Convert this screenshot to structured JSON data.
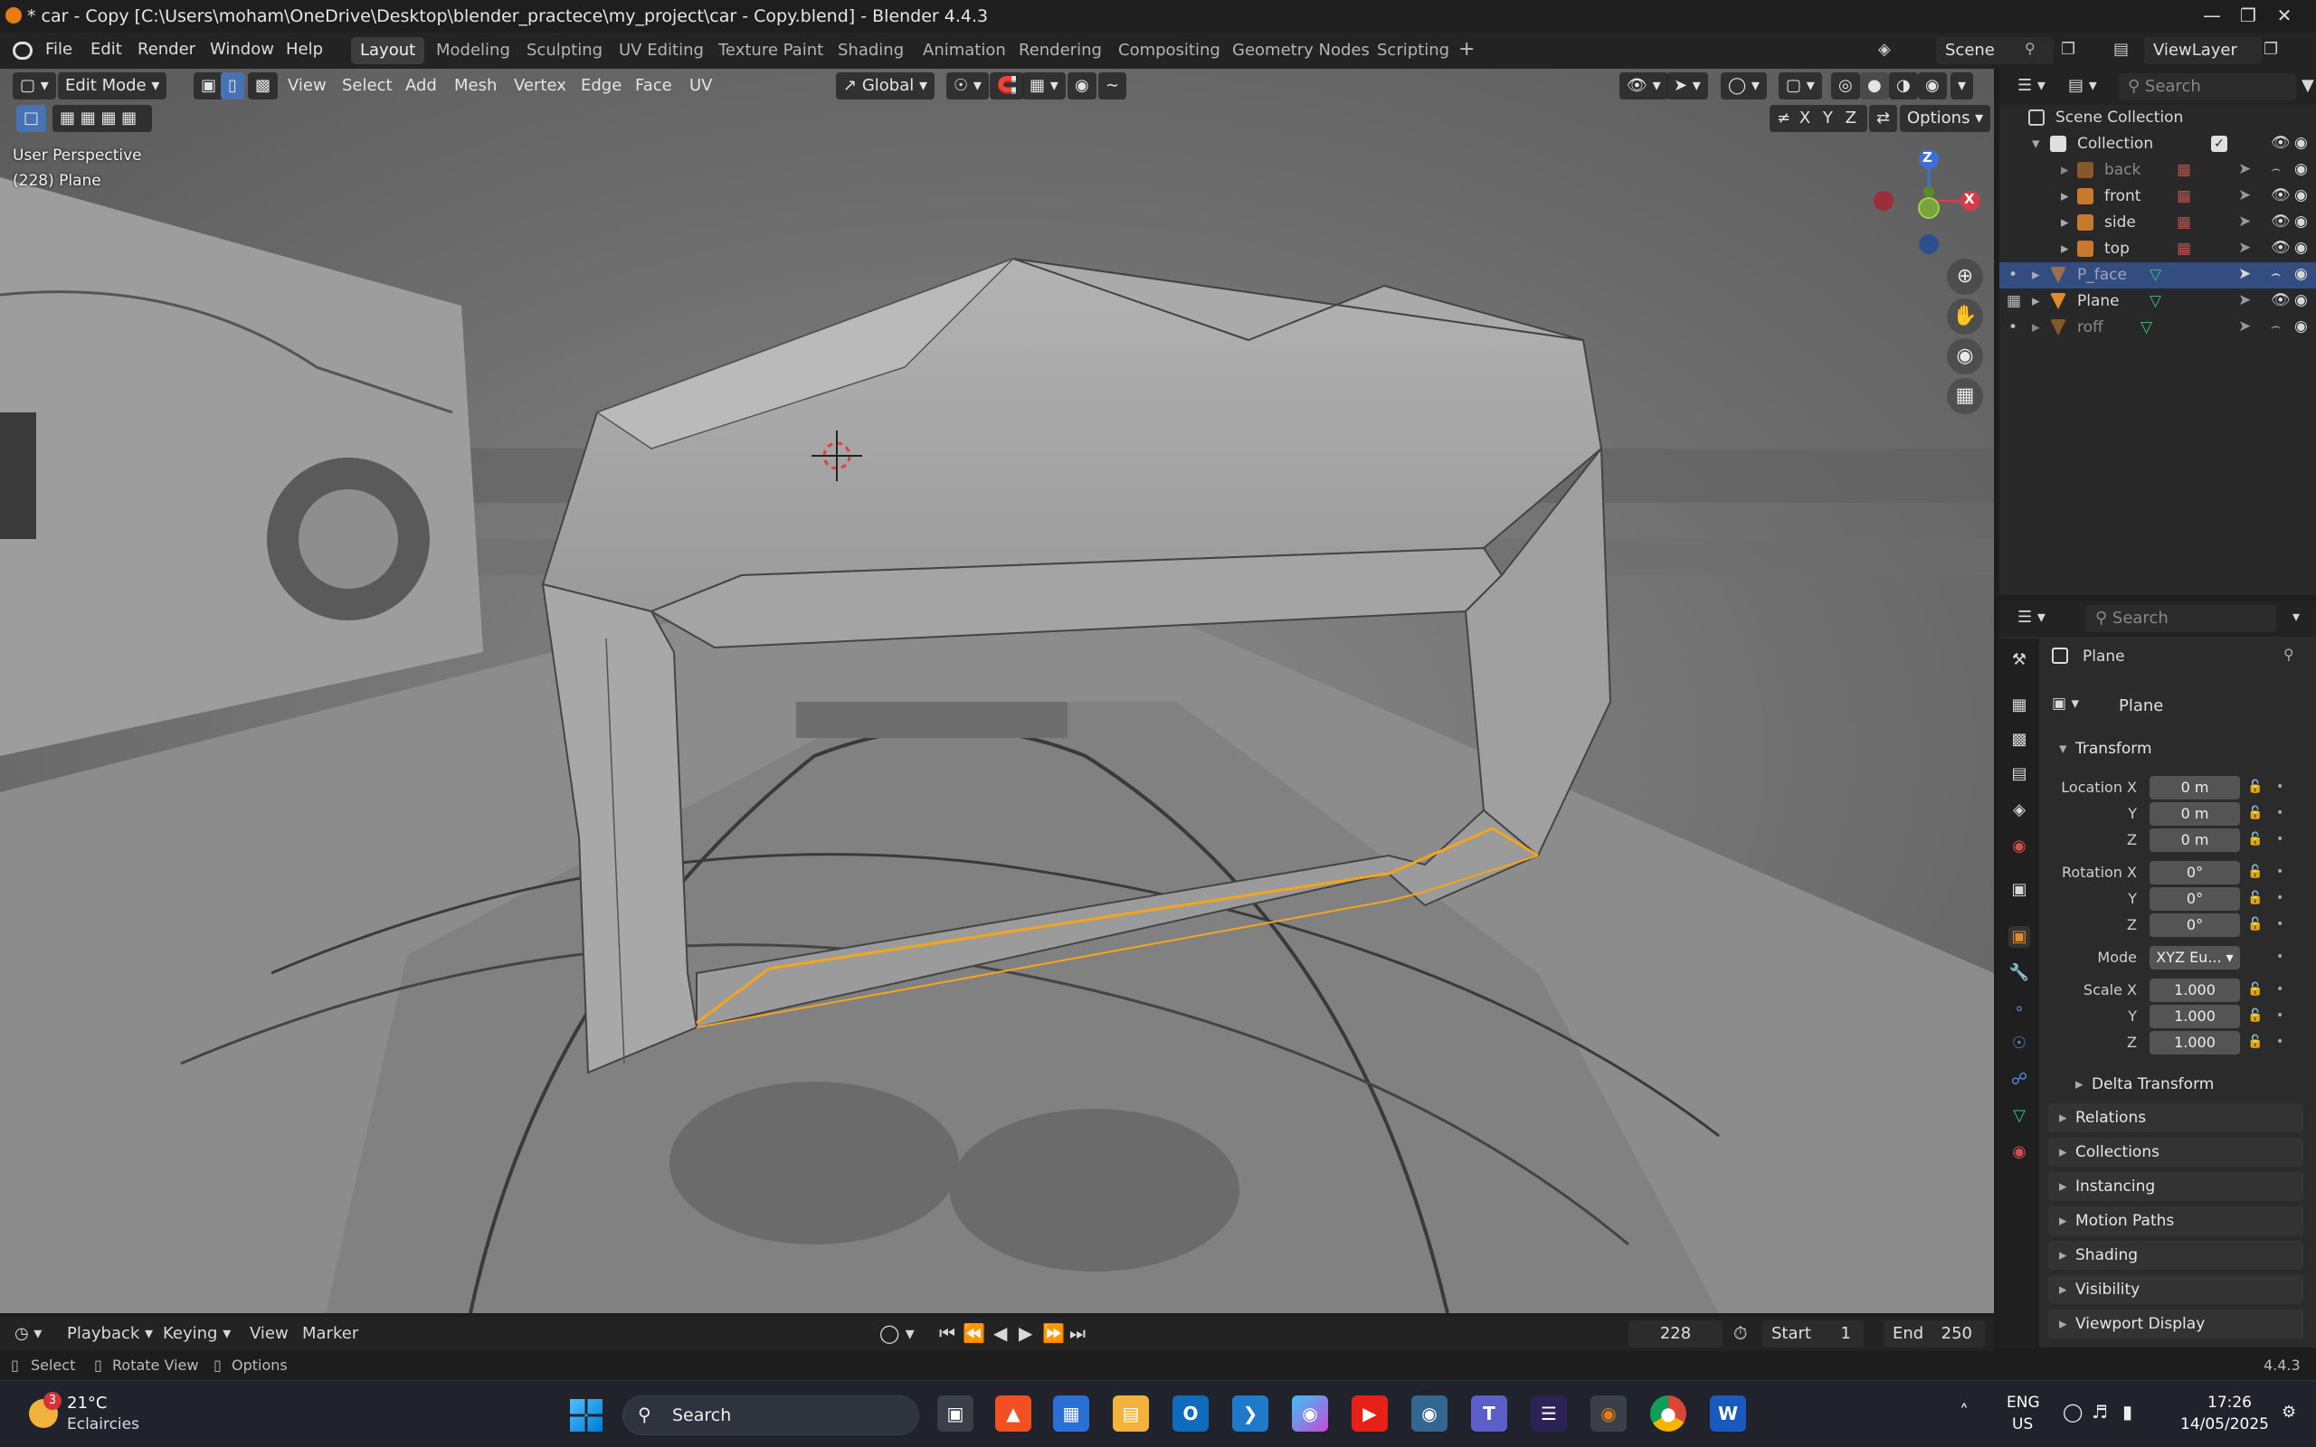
{
  "window": {
    "title": "* car - Copy [C:\\Users\\moham\\OneDrive\\Desktop\\blender_practece\\my_project\\car - Copy.blend] - Blender 4.4.3"
  },
  "menu": [
    "File",
    "Edit",
    "Render",
    "Window",
    "Help"
  ],
  "workspaces": [
    "Layout",
    "Modeling",
    "Sculpting",
    "UV Editing",
    "Texture Paint",
    "Shading",
    "Animation",
    "Rendering",
    "Compositing",
    "Geometry Nodes",
    "Scripting"
  ],
  "active_workspace": "Layout",
  "scene": {
    "name": "Scene",
    "view_layer": "ViewLayer"
  },
  "viewport": {
    "mode": "Edit Mode",
    "menus": [
      "View",
      "Select",
      "Add",
      "Mesh",
      "Vertex",
      "Edge",
      "Face",
      "UV"
    ],
    "orientation": "Global",
    "options_label": "Options",
    "axes": [
      "X",
      "Y",
      "Z"
    ],
    "overlay_line1": "User Perspective",
    "overlay_line2": "(228) Plane",
    "gizmo": {
      "z": "Z",
      "x": "X"
    }
  },
  "outliner": {
    "search_placeholder": "Search",
    "scene_collection": "Scene Collection",
    "collection": "Collection",
    "items": [
      {
        "name": "back",
        "dim": true
      },
      {
        "name": "front",
        "dim": false
      },
      {
        "name": "side",
        "dim": false
      },
      {
        "name": "top",
        "dim": false
      },
      {
        "name": "P_face",
        "dim": true,
        "selected": true
      },
      {
        "name": "Plane",
        "dim": false
      },
      {
        "name": "roff",
        "dim": true
      }
    ]
  },
  "properties": {
    "search_placeholder": "Search",
    "object_name": "Plane",
    "data_name": "Plane",
    "transform": {
      "header": "Transform",
      "location_label": "Location X",
      "location": [
        "0 m",
        "0 m",
        "0 m"
      ],
      "rotation_label": "Rotation X",
      "rotation": [
        "0°",
        "0°",
        "0°"
      ],
      "mode_label": "Mode",
      "mode_value": "XYZ Eu...",
      "scale_label": "Scale X",
      "scale": [
        "1.000",
        "1.000",
        "1.000"
      ],
      "y": "Y",
      "z": "Z",
      "delta": "Delta Transform"
    },
    "panels": [
      "Relations",
      "Collections",
      "Instancing",
      "Motion Paths",
      "Shading",
      "Visibility",
      "Viewport Display"
    ]
  },
  "timeline": {
    "menus": [
      "Playback",
      "Keying",
      "View",
      "Marker"
    ],
    "current_frame": "228",
    "start_label": "Start",
    "start": "1",
    "end_label": "End",
    "end": "250"
  },
  "statusbar": {
    "hints": [
      "Select",
      "Rotate View",
      "Options"
    ],
    "version": "4.4.3"
  },
  "taskbar": {
    "weather_badge": "3",
    "weather_temp": "21°C",
    "weather_desc": "Eclaircies",
    "search": "Search",
    "lang1": "ENG",
    "lang2": "US",
    "time": "17:26",
    "date": "14/05/2025"
  }
}
